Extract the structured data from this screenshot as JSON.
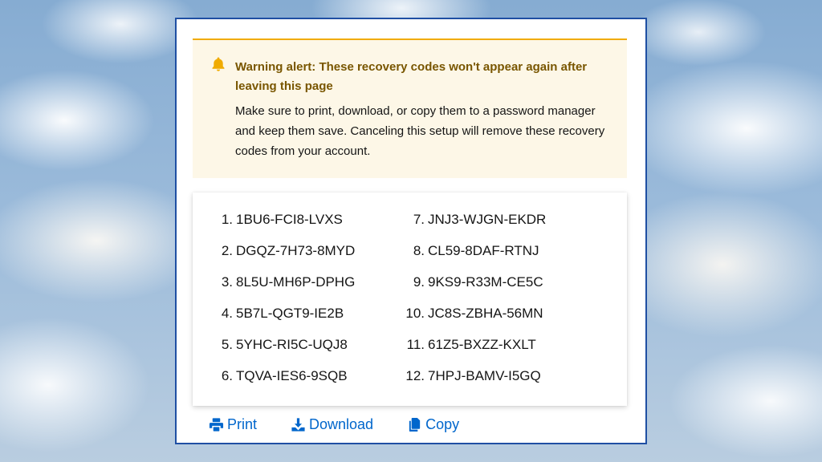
{
  "alert": {
    "variant": "warning",
    "icon": "bell-icon",
    "color": "#f0ab00",
    "title": "Warning alert: These recovery codes won't appear again after leaving this page",
    "body": "Make sure to print, download, or copy them to a password manager and keep them save. Canceling this setup will remove these recovery codes from your account."
  },
  "codes": [
    {
      "num": "1.",
      "code": "1BU6-FCI8-LVXS"
    },
    {
      "num": "2.",
      "code": "DGQZ-7H73-8MYD"
    },
    {
      "num": "3.",
      "code": "8L5U-MH6P-DPHG"
    },
    {
      "num": "4.",
      "code": "5B7L-QGT9-IE2B"
    },
    {
      "num": "5.",
      "code": "5YHC-RI5C-UQJ8"
    },
    {
      "num": "6.",
      "code": "TQVA-IES6-9SQB"
    },
    {
      "num": "7.",
      "code": "JNJ3-WJGN-EKDR"
    },
    {
      "num": "8.",
      "code": "CL59-8DAF-RTNJ"
    },
    {
      "num": "9.",
      "code": "9KS9-R33M-CE5C"
    },
    {
      "num": "10.",
      "code": "JC8S-ZBHA-56MN"
    },
    {
      "num": "11.",
      "code": "61Z5-BXZZ-KXLT"
    },
    {
      "num": "12.",
      "code": "7HPJ-BAMV-I5GQ"
    }
  ],
  "actions": {
    "print": {
      "label": "Print",
      "icon": "print-icon"
    },
    "download": {
      "label": "Download",
      "icon": "download-icon"
    },
    "copy": {
      "label": "Copy",
      "icon": "copy-icon"
    }
  },
  "colors": {
    "link": "#0066cc",
    "warning_title": "#795600",
    "frame_border": "#1f4fa3"
  }
}
